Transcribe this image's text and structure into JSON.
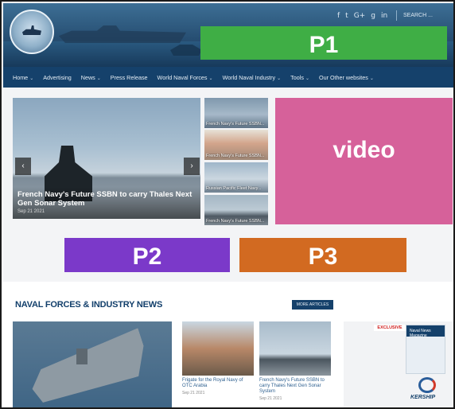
{
  "header": {
    "social": [
      "f",
      "t",
      "G+",
      "g",
      "in"
    ],
    "search_placeholder": "SEARCH ..."
  },
  "placeholders": {
    "p1": "P1",
    "video": "video",
    "p2": "P2",
    "p3": "P3"
  },
  "nav": {
    "items": [
      {
        "label": "Home"
      },
      {
        "label": "Advertising"
      },
      {
        "label": "News"
      },
      {
        "label": "Press Release"
      },
      {
        "label": "World Naval Forces"
      },
      {
        "label": "World Naval Industry"
      },
      {
        "label": "Tools"
      },
      {
        "label": "Our Other websites"
      }
    ]
  },
  "slider": {
    "caption": "French Navy's Future SSBN to carry Thales Next Gen Sonar System",
    "date": "Sep 21 2021",
    "prev": "‹",
    "next": "›"
  },
  "thumbs": [
    {
      "label": "French Navy's Future SSBN..."
    },
    {
      "label": "French Navy's Future SSBN..."
    },
    {
      "label": "Russian Pacific Fleet Navy..."
    },
    {
      "label": "French Navy's Future SSBN..."
    }
  ],
  "section": {
    "title": "NAVAL FORCES & INDUSTRY NEWS",
    "more_label": "MORE ARTICLES"
  },
  "cards": [
    {
      "title": "Frigate for the Royal Navy of OTC Arabia",
      "date": "Sep 21 2021"
    },
    {
      "title": "French Navy's Future SSBN to carry Thales Next Gen Sonar System",
      "date": "Sep 21 2021"
    }
  ],
  "ad": {
    "badge": "EXCLUSIVE",
    "mag_title": "Naval News Magazine",
    "brand": "KERSHIP"
  }
}
